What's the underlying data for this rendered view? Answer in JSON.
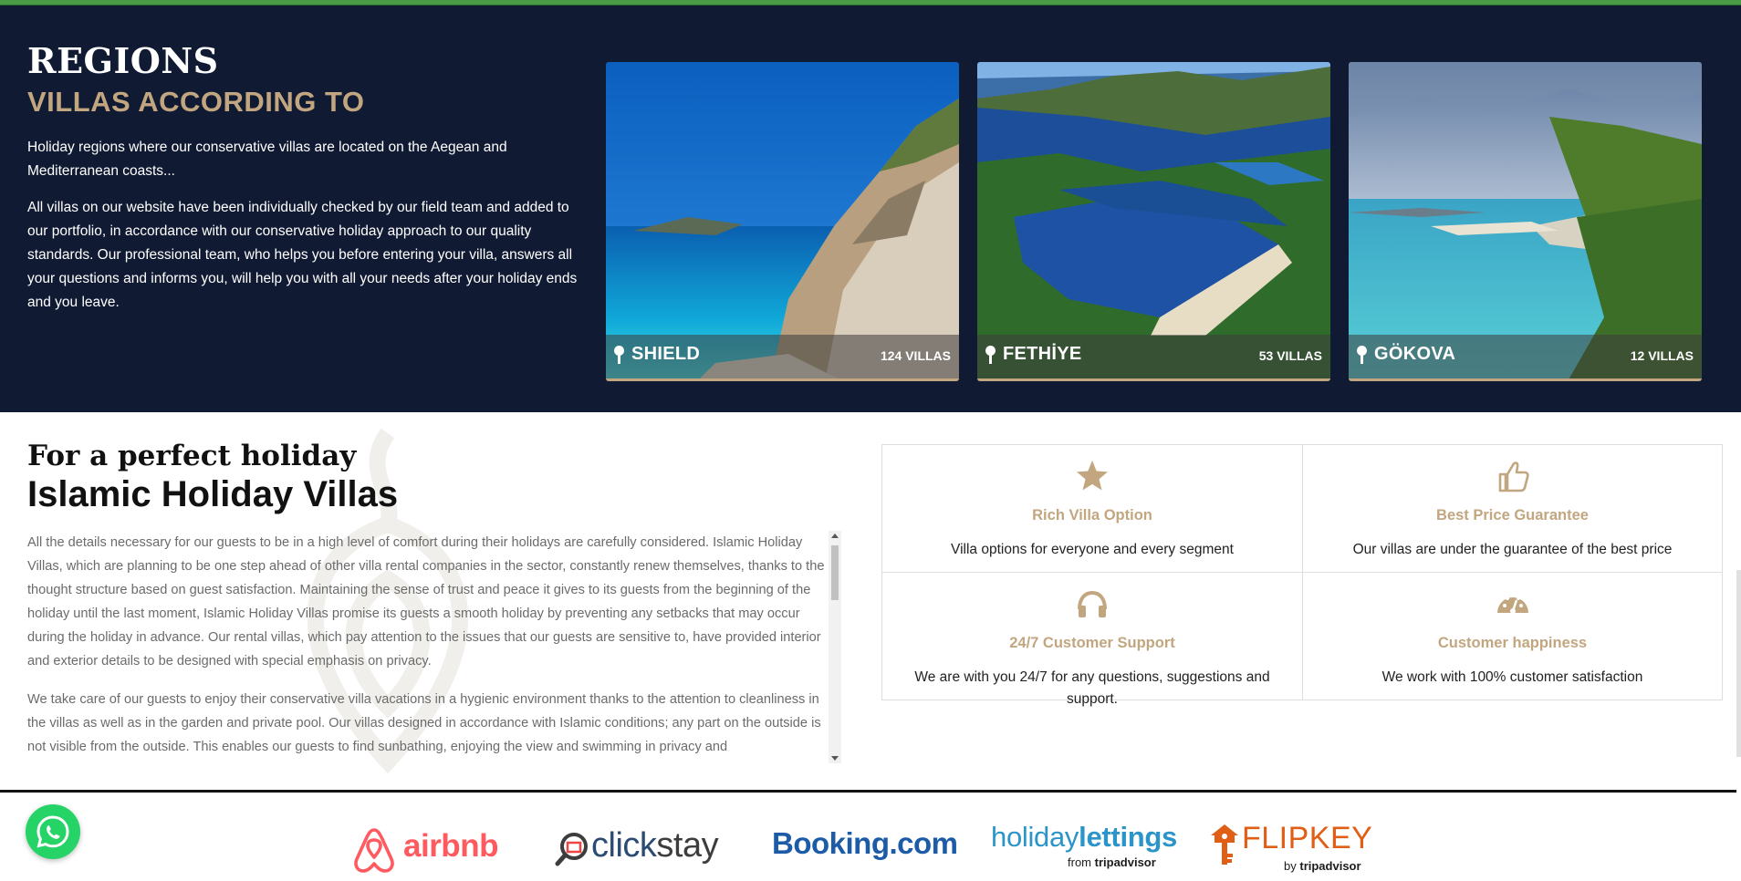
{
  "regions": {
    "title": "REGIONS",
    "subtitle": "VILLAS ACCORDING TO",
    "paragraph1": "Holiday regions where our conservative villas are located on the Aegean and Mediterranean coasts...",
    "paragraph2": "All villas on our website have been individually checked by our field team and added to our portfolio, in accordance with our conservative holiday approach to our quality standards. Our professional team, who helps you before entering your villa, answers all your questions and informs you, will help you with all your needs after your holiday ends and you leave.",
    "cards": [
      {
        "name": "SHIELD",
        "count": "124 VILLAS"
      },
      {
        "name": "FETHİYE",
        "count": "53 VILLAS"
      },
      {
        "name": "GÖKOVA",
        "count": "12 VILLAS"
      }
    ]
  },
  "holiday": {
    "title": "For a perfect holiday",
    "subtitle": "Islamic Holiday Villas",
    "paragraph1": "All the details necessary for our guests to be in a high level of comfort during their holidays are carefully considered. Islamic Holiday Villas, which are planning to be one step ahead of other villa rental companies in the sector, constantly renew themselves, thanks to the thought structure based on guest satisfaction. Maintaining the sense of trust and peace it gives to its guests from the beginning of the holiday until the last moment, Islamic Holiday Villas promise its guests a smooth holiday by preventing any setbacks that may occur during the holiday in advance. Our rental villas, which pay attention to the issues that our guests are sensitive to, have provided interior and exterior details to be designed with special emphasis on privacy.",
    "paragraph2": "We take care of our guests to enjoy their conservative villa vacations in a hygienic environment thanks to the attention to cleanliness in the villas as well as in the garden and private pool. Our villas designed in accordance with Islamic conditions; any part on the outside is not visible from the outside. This enables our guests to find sunbathing, enjoying the view and swimming in privacy and"
  },
  "features": [
    {
      "icon": "star-icon",
      "title": "Rich Villa Option",
      "desc": "Villa options for everyone and every segment"
    },
    {
      "icon": "thumbs-up-icon",
      "title": "Best Price Guarantee",
      "desc": "Our villas are under the guarantee of the best price"
    },
    {
      "icon": "headphones-icon",
      "title": "24/7 Customer Support",
      "desc": "We are with you 24/7 for any questions, suggestions and support."
    },
    {
      "icon": "dashboard-icon",
      "title": "Customer happiness",
      "desc": "We work with 100% customer satisfaction"
    }
  ],
  "partners": {
    "airbnb": "airbnb",
    "clickstay_a": "click",
    "clickstay_b": "stay",
    "booking": "Booking.com",
    "holiday_a": "holiday",
    "holiday_b": "lettings",
    "holiday_from": "from",
    "holiday_ta": "tripadvisor",
    "flipkey": "FLIPKEY",
    "flipkey_by": "by",
    "flipkey_ta": "tripadvisor"
  },
  "colors": {
    "navy": "#111a33",
    "gold": "#c2a680",
    "green": "#4b9a45",
    "whatsapp": "#25d366"
  }
}
